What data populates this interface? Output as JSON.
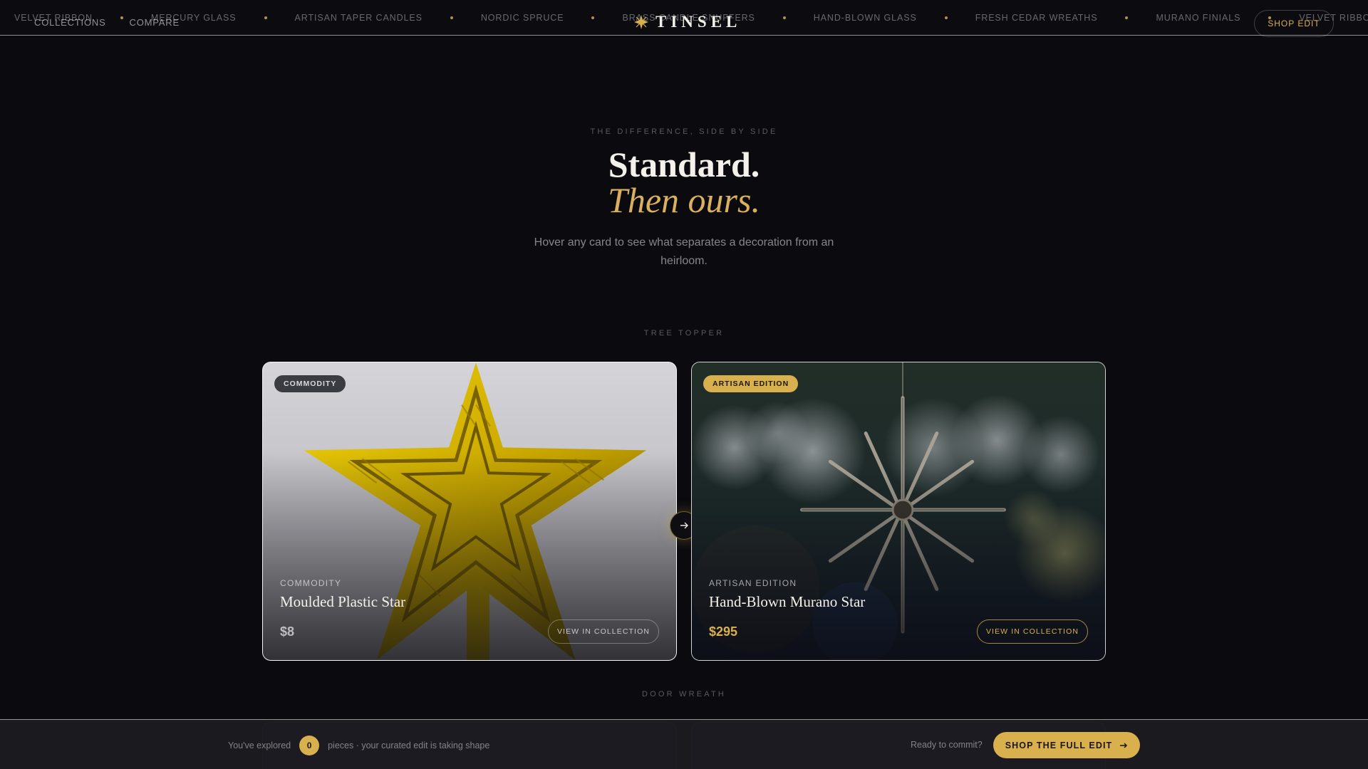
{
  "marquee": {
    "items": [
      "VELVET RIBBON",
      "MERCURY GLASS",
      "ARTISAN TAPER CANDLES",
      "NORDIC SPRUCE",
      "BRASS CANDLE SNUFFERS",
      "HAND-BLOWN GLASS",
      "FRESH CEDAR WREATHS",
      "MURANO FINIALS",
      "VELVET RIBBON"
    ]
  },
  "nav": {
    "collections": "COLLECTIONS",
    "compare": "COMPARE"
  },
  "brand": {
    "name": "TINSEL",
    "star_icon": "star-icon",
    "accent_color": "#d9b04e"
  },
  "header": {
    "shop_edit": "SHOP EDIT"
  },
  "hero": {
    "eyebrow": "THE DIFFERENCE, SIDE BY SIDE",
    "title": "Standard.",
    "title_em": "Then ours.",
    "subtitle": "Hover any card to see what separates a decoration from an heirloom."
  },
  "sections": [
    {
      "label": "TREE TOPPER",
      "commodity": {
        "badge": "COMMODITY",
        "tier": "COMMODITY",
        "name": "Moulded Plastic Star",
        "price": "$8",
        "cta": "VIEW IN COLLECTION"
      },
      "artisan": {
        "badge": "ARTISAN EDITION",
        "tier": "ARTISAN EDITION",
        "name": "Hand-Blown Murano Star",
        "price": "$295",
        "cta": "VIEW IN COLLECTION"
      }
    },
    {
      "label": "DOOR WREATH"
    }
  ],
  "compare_arrow_icon": "arrow-right-icon",
  "bottombar": {
    "explored_prefix": "You've explored",
    "explored_count": "0",
    "explored_suffix": "pieces · your curated edit is taking shape",
    "ready": "Ready to commit?",
    "cta": "SHOP THE FULL EDIT",
    "cta_icon": "arrow-right-icon"
  }
}
